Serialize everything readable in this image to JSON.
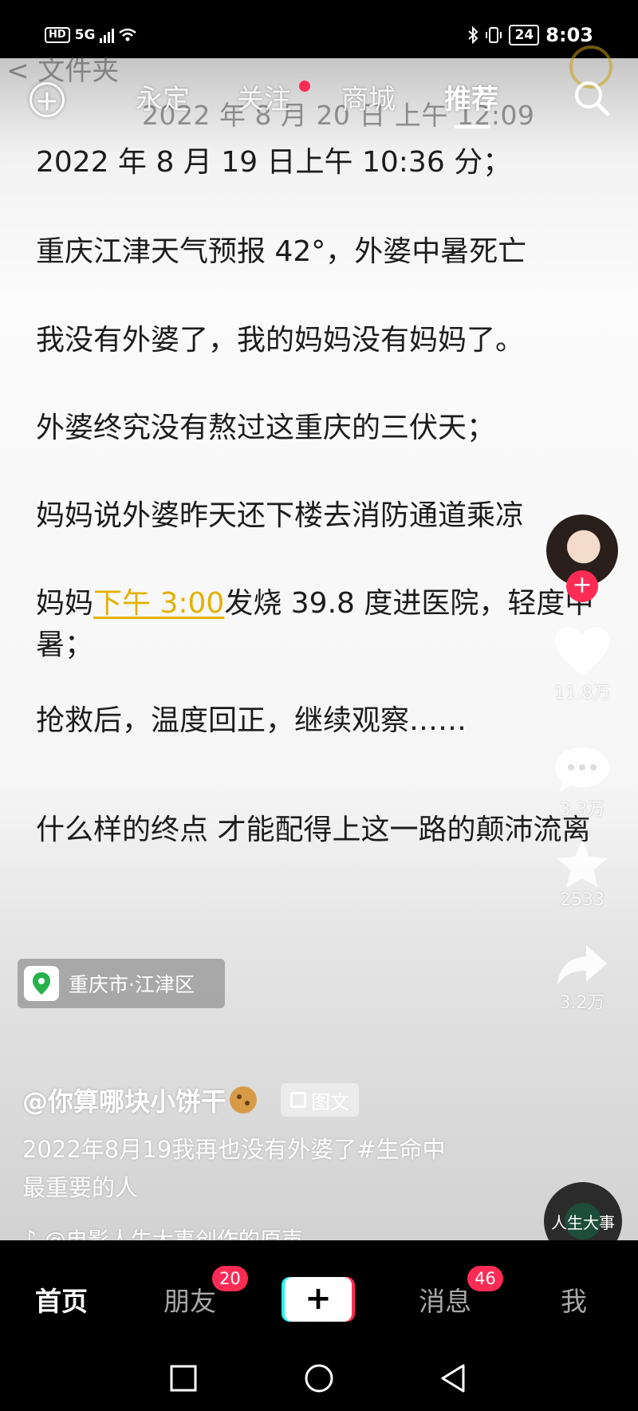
{
  "status_bar": {
    "hd": "HD",
    "network": "5G",
    "battery": "24",
    "time": "8:03"
  },
  "header_ghost": {
    "back_text": "< 文件夹",
    "time_text": "2022 年 8 月 20 日 上午 12:09"
  },
  "nav": {
    "tabs": [
      "永定",
      "关注",
      "商城",
      "推荐"
    ],
    "active_tab": "推荐"
  },
  "post": {
    "lines": [
      "2022 年 8 月 19 日上午 10:36 分；",
      "重庆江津天气预报 42°，外婆中暑死亡",
      "我没有外婆了，我的妈妈没有妈妈了。",
      "外婆终究没有熬过这重庆的三伏天；",
      "妈妈说外婆昨天还下楼去消防通道乘凉",
      "抢救后，温度回正，继续观察……",
      "什么样的终点 才能配得上这一路的颠沛流离"
    ],
    "line_mama": {
      "prefix": "妈妈",
      "time_link": "下午 3:00",
      "suffix": "发烧 39.8 度进医院，轻度中暑；"
    }
  },
  "rail": {
    "like_count": "11.8万",
    "comment_count": "3.3万",
    "favorite_count": "2533",
    "share_count": "3.2万",
    "follow_plus": "+"
  },
  "location": "重庆市·江津区",
  "author": "@你算哪块小饼干",
  "type_badge": "图文",
  "caption": "2022年8月19我再也没有外婆了#生命中最重要的人",
  "music": "@电影人生大事创作的原声",
  "music_disc_label": "人生大事",
  "progress": {
    "segments": 4,
    "current_fraction": 0.55
  },
  "bottom_tabs": {
    "home": "首页",
    "friends": "朋友",
    "create": "+",
    "messages": "消息",
    "me": "我",
    "friends_badge": "20",
    "messages_badge": "46"
  },
  "colors": {
    "accent_red": "#fe2c55",
    "accent_cyan": "#25f4ee",
    "time_link": "#e2b100"
  }
}
